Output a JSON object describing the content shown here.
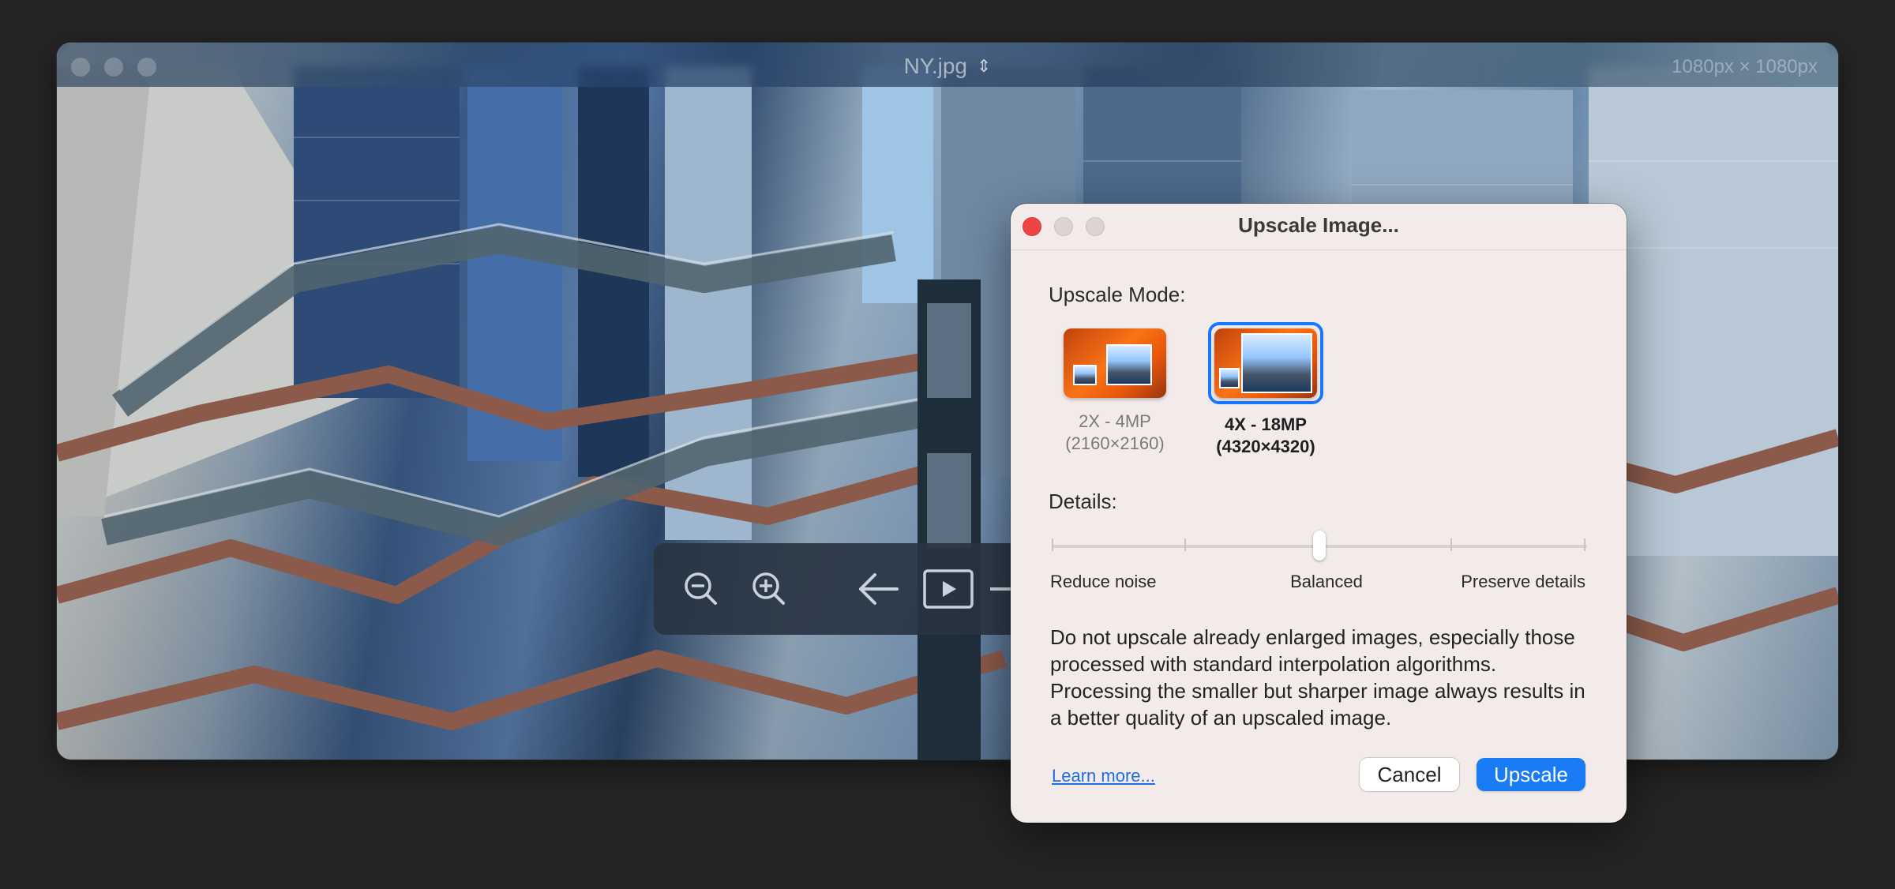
{
  "viewer": {
    "title": "NY.jpg",
    "dimensions": "1080px × 1080px",
    "toolbar": {
      "icons": [
        "zoom-out-icon",
        "zoom-in-icon",
        "arrow-left-icon",
        "play-icon"
      ]
    }
  },
  "dialog": {
    "title": "Upscale Image...",
    "mode_label": "Upscale Mode:",
    "modes": [
      {
        "line1": "2X - 4MP",
        "line2": "(2160×2160)",
        "selected": false
      },
      {
        "line1": "4X - 18MP",
        "line2": "(4320×4320)",
        "selected": true
      }
    ],
    "details_label": "Details:",
    "slider": {
      "value": 0.5,
      "labels": [
        "Reduce noise",
        "Balanced",
        "Preserve details"
      ]
    },
    "description": "Do not upscale already enlarged images, especially those processed with standard interpolation algorithms. Processing the smaller but sharper image always results in a better quality of an upscaled image.",
    "learn_more": "Learn more...",
    "cancel": "Cancel",
    "upscale": "Upscale",
    "accent_color": "#1a7cf5",
    "close_color": "#ef4444"
  }
}
